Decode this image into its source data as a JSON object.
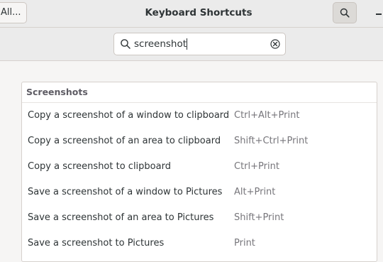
{
  "window": {
    "title": "Keyboard Shortcuts"
  },
  "header": {
    "back_label": "All...",
    "search_toggle_icon": "search-icon",
    "minimize_icon": "minimize-icon"
  },
  "search": {
    "value": "screenshot",
    "search_icon": "search-icon",
    "clear_icon": "edit-clear-icon"
  },
  "section": {
    "title": "Screenshots",
    "rows": [
      {
        "name": "Copy a screenshot of a window to clipboard",
        "accel": "Ctrl+Alt+Print"
      },
      {
        "name": "Copy a screenshot of an area to clipboard",
        "accel": "Shift+Ctrl+Print"
      },
      {
        "name": "Copy a screenshot to clipboard",
        "accel": "Ctrl+Print"
      },
      {
        "name": "Save a screenshot of a window to Pictures",
        "accel": "Alt+Print"
      },
      {
        "name": "Save a screenshot of an area to Pictures",
        "accel": "Shift+Print"
      },
      {
        "name": "Save a screenshot to Pictures",
        "accel": "Print"
      }
    ]
  },
  "colors": {
    "headerbar_bg": "#ebebeb",
    "window_bg": "#f6f5f4",
    "text": "#2e3436",
    "accel_text": "#77767b",
    "section_text": "#5e5c64"
  }
}
